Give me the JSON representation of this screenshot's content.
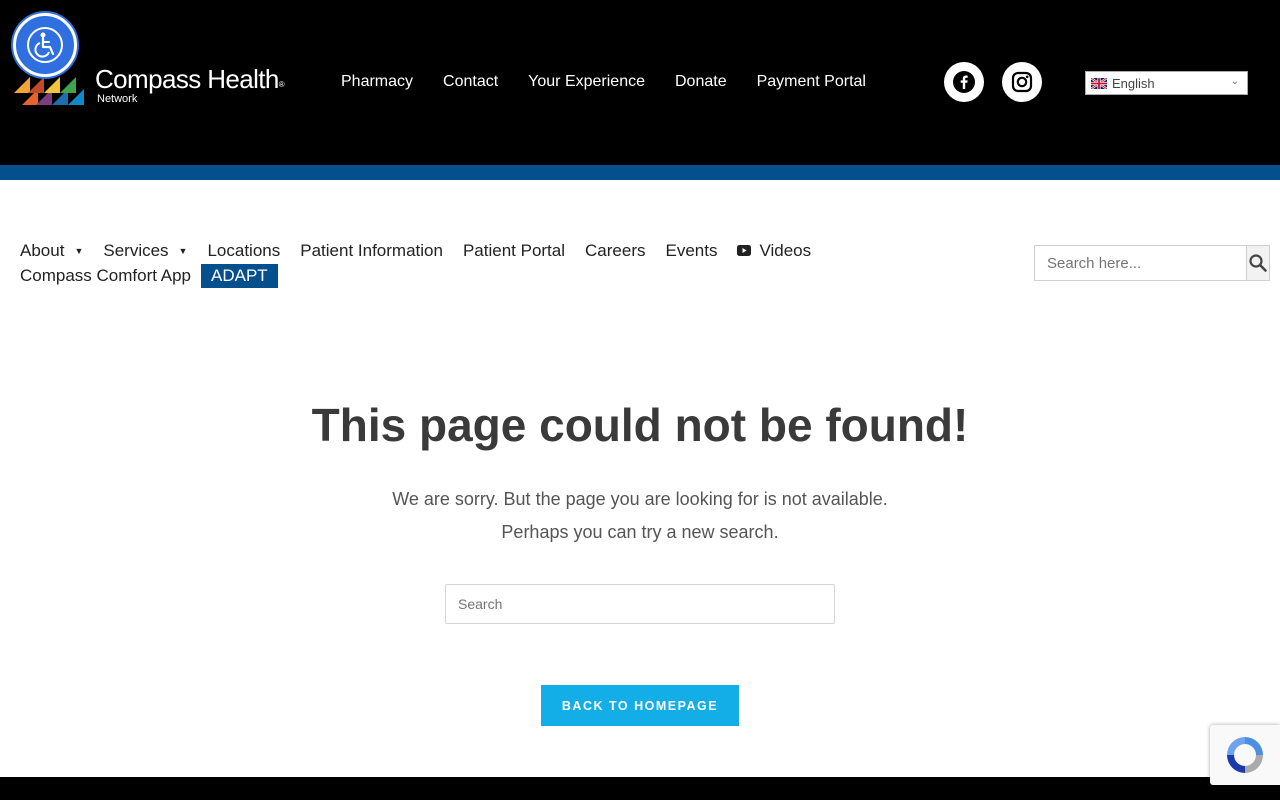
{
  "header": {
    "logo": {
      "name": "Compass Health",
      "registered": "®",
      "sub": "Network"
    },
    "nav": [
      "Pharmacy",
      "Contact",
      "Your Experience",
      "Donate",
      "Payment Portal"
    ],
    "social": {
      "facebook_icon": "facebook-icon",
      "instagram_icon": "instagram-icon"
    },
    "language": {
      "selected": "English",
      "flag_icon": "uk-flag-icon"
    },
    "colors": {
      "background": "#000000",
      "stripe": "#04508f"
    }
  },
  "accessibility": {
    "icon": "wheelchair-icon",
    "color": "#2f6fe0"
  },
  "mainnav": {
    "row1": [
      {
        "label": "About",
        "dropdown": true
      },
      {
        "label": "Services",
        "dropdown": true
      },
      {
        "label": "Locations"
      },
      {
        "label": "Patient Information"
      },
      {
        "label": "Patient Portal"
      },
      {
        "label": "Careers"
      },
      {
        "label": "Events"
      },
      {
        "label": "Videos",
        "icon": "youtube-icon"
      }
    ],
    "row2": [
      {
        "label": "Compass Comfort App"
      },
      {
        "label": "ADAPT",
        "highlighted": true
      }
    ],
    "search_placeholder": "Search here..."
  },
  "error": {
    "title": "This page could not be found!",
    "line1": "We are sorry. But the page you are looking for is not available.",
    "line2": "Perhaps you can try a new search.",
    "search_placeholder": "Search",
    "button": "BACK TO HOMEPAGE",
    "button_color": "#13aee8"
  }
}
